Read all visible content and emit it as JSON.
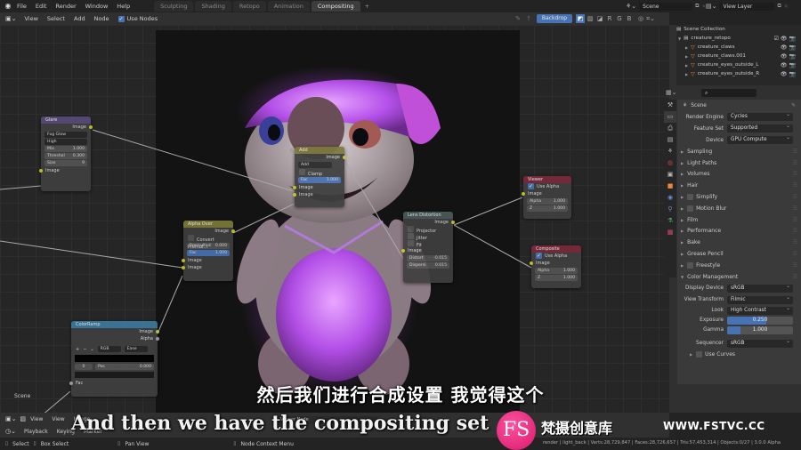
{
  "topbar": {
    "menu": [
      "File",
      "Edit",
      "Render",
      "Window",
      "Help"
    ],
    "workspaces": [
      {
        "label": "Sculpting",
        "active": false
      },
      {
        "label": "Shading",
        "active": false
      },
      {
        "label": "Retopo",
        "active": false
      },
      {
        "label": "Animation",
        "active": false
      },
      {
        "label": "Compositing",
        "active": true
      }
    ],
    "add_workspace": "+",
    "scene": "Scene",
    "view_layer": "View Layer"
  },
  "node_header": {
    "menu": [
      "View",
      "Select",
      "Add",
      "Node"
    ],
    "use_nodes_label": "Use Nodes",
    "use_nodes_checked": true,
    "backdrop_label": "Backdrop",
    "channels": [
      "R",
      "G",
      "B"
    ]
  },
  "nodes": {
    "glare": {
      "title": "Glare",
      "output": "Image",
      "type": "Fog Glow",
      "quality": "High",
      "mix_label": "Mix",
      "mix": "1.000",
      "threshold_label": "Threshol",
      "threshold": "0.300",
      "size_label": "Size",
      "size": "9",
      "input": "Image"
    },
    "add": {
      "title": "Add",
      "output": "Image",
      "blend": "Add",
      "clamp_label": "Clamp",
      "fac_label": "Fac",
      "fac": "1.000",
      "inputs": [
        "Image",
        "Image"
      ]
    },
    "alpha_over": {
      "title": "Alpha Over",
      "output": "Image",
      "convert_label": "Convert Premul...",
      "premul_label": "Premultipli",
      "premul": "0.000",
      "fac_label": "Fac",
      "fac": "1.000",
      "inputs": [
        "Image",
        "Image"
      ]
    },
    "lens_distortion": {
      "title": "Lens Distortion",
      "output": "Image",
      "options": [
        "Projector",
        "Jitter",
        "Fit"
      ],
      "input": "Image",
      "distort_label": "Distort",
      "distort": "-0.015",
      "dispersion_label": "Dispersi",
      "dispersion": "0.015"
    },
    "viewer": {
      "title": "Viewer",
      "use_alpha_label": "Use Alpha",
      "input": "Image",
      "alpha_label": "Alpha",
      "alpha": "1.000",
      "z_label": "Z",
      "z": "1.000"
    },
    "composite": {
      "title": "Composite",
      "use_alpha_label": "Use Alpha",
      "input": "Image",
      "alpha_label": "Alpha",
      "alpha": "1.000",
      "z_label": "Z",
      "z": "1.000"
    },
    "colorramp": {
      "title": "ColorRamp",
      "outputs": [
        "Image",
        "Alpha"
      ],
      "mode": "RGB",
      "interp": "Ease",
      "index": "0",
      "pos_label": "Pos",
      "pos": "0.000",
      "input": "Fac"
    },
    "scene_label": "Scene"
  },
  "outliner": {
    "root": "Scene Collection",
    "collection": "creature_retopo",
    "items": [
      "creature_claws",
      "creature_claws.001",
      "creature_eyes_outside_L",
      "creature_eyes_outside_R"
    ]
  },
  "properties": {
    "context": "Scene",
    "render_engine_label": "Render Engine",
    "render_engine": "Cycles",
    "feature_set_label": "Feature Set",
    "feature_set": "Supported",
    "device_label": "Device",
    "device": "GPU Compute",
    "panels": [
      {
        "label": "Sampling",
        "checkbox": false
      },
      {
        "label": "Light Paths",
        "checkbox": false
      },
      {
        "label": "Volumes",
        "checkbox": false
      },
      {
        "label": "Hair",
        "checkbox": false
      },
      {
        "label": "Simplify",
        "checkbox": true
      },
      {
        "label": "Motion Blur",
        "checkbox": true
      },
      {
        "label": "Film",
        "checkbox": false
      },
      {
        "label": "Performance",
        "checkbox": false
      },
      {
        "label": "Bake",
        "checkbox": false
      },
      {
        "label": "Grease Pencil",
        "checkbox": false
      },
      {
        "label": "Freestyle",
        "checkbox": true
      }
    ],
    "color_management": {
      "label": "Color Management",
      "display_device_label": "Display Device",
      "display_device": "sRGB",
      "view_transform_label": "View Transform",
      "view_transform": "Filmic",
      "look_label": "Look",
      "look": "High Contrast",
      "exposure_label": "Exposure",
      "exposure": "0.250",
      "exposure_fill": 0.6,
      "gamma_label": "Gamma",
      "gamma": "1.000",
      "gamma_fill": 0.2,
      "sequencer_label": "Sequencer",
      "sequencer": "sRGB",
      "use_curves_label": "Use Curves"
    }
  },
  "bottom": {
    "row1": [
      "View",
      "View",
      "Image"
    ],
    "row2": [
      "Playback",
      "Keying",
      "Marker"
    ],
    "viewer_node": "Viewer Node",
    "status": [
      "Select",
      "Box Select",
      "Pan View",
      "Node Context Menu"
    ],
    "stats": "render | light_back | Verts:28,729,847 | Faces:28,726,657 | Tris:57,453,314 | Objects:0/27 | 3.0.0 Alpha"
  },
  "subtitles": {
    "chinese": "然后我们进行合成设置 我觉得这个",
    "english": "And then we have the compositing set"
  },
  "watermark": {
    "logo": "FS",
    "name": "梵摄创意库",
    "url": "WWW.FSTVC.CC"
  }
}
